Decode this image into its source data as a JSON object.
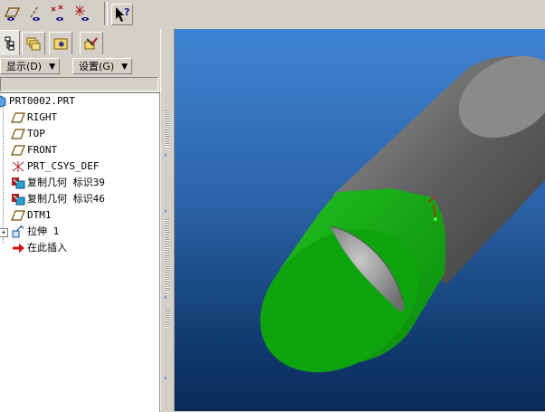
{
  "toolbar": {
    "icons": [
      "datum-plane-display-icon",
      "datum-axis-display-icon",
      "datum-point-display-icon",
      "coordinate-system-display-icon",
      "context-help-icon"
    ]
  },
  "left_panel": {
    "tabs": [
      "model-tree-tab",
      "layers-tab",
      "favorites-tab",
      "tools-tab"
    ],
    "menu": {
      "show_label": "显示(D)",
      "settings_label": "设置(G)"
    },
    "tree": {
      "root": "PRT0002.PRT",
      "items": [
        {
          "label": "RIGHT",
          "icon": "datum-plane-icon"
        },
        {
          "label": "TOP",
          "icon": "datum-plane-icon"
        },
        {
          "label": "FRONT",
          "icon": "datum-plane-icon"
        },
        {
          "label": "PRT_CSYS_DEF",
          "icon": "coordinate-system-icon"
        },
        {
          "label": "复制几何 标识39",
          "icon": "copy-geometry-icon"
        },
        {
          "label": "复制几何 标识46",
          "icon": "copy-geometry-icon"
        },
        {
          "label": "DTM1",
          "icon": "datum-plane-icon"
        },
        {
          "label": "拉伸 1",
          "icon": "extrude-icon"
        },
        {
          "label": "在此插入",
          "icon": "insert-here-arrow-icon"
        }
      ]
    }
  },
  "viewport": {
    "background_colors": [
      "#3f85d5",
      "#0b2a58"
    ],
    "body_colors": {
      "cylinder": "#7a7a7a",
      "extrude": "#119e11",
      "cut": "#9a9a9a"
    }
  }
}
